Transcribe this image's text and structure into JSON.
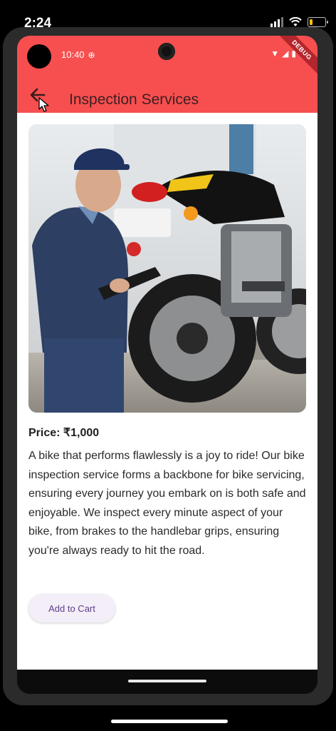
{
  "outer_status": {
    "time": "2:24"
  },
  "inner_status": {
    "time": "10:40"
  },
  "debug_banner": "DEBUG",
  "appbar": {
    "title": "Inspection Services"
  },
  "product": {
    "price": "Price: ₹1,000",
    "description": "A bike that performs flawlessly is a joy to ride! Our bike inspection service forms a backbone for bike servicing, ensuring every journey you embark on is both safe and enjoyable. We inspect every minute aspect of your bike, from brakes to the handlebar grips, ensuring you're always ready to hit the road.",
    "add_to_cart_label": "Add to Cart"
  },
  "colors": {
    "appbar": "#f74f4f",
    "button_bg": "#f3eef7",
    "button_text": "#5b3e8a"
  },
  "icons": [
    "signal-icon",
    "wifi-icon",
    "battery-icon",
    "back-arrow-icon",
    "cursor-icon"
  ]
}
